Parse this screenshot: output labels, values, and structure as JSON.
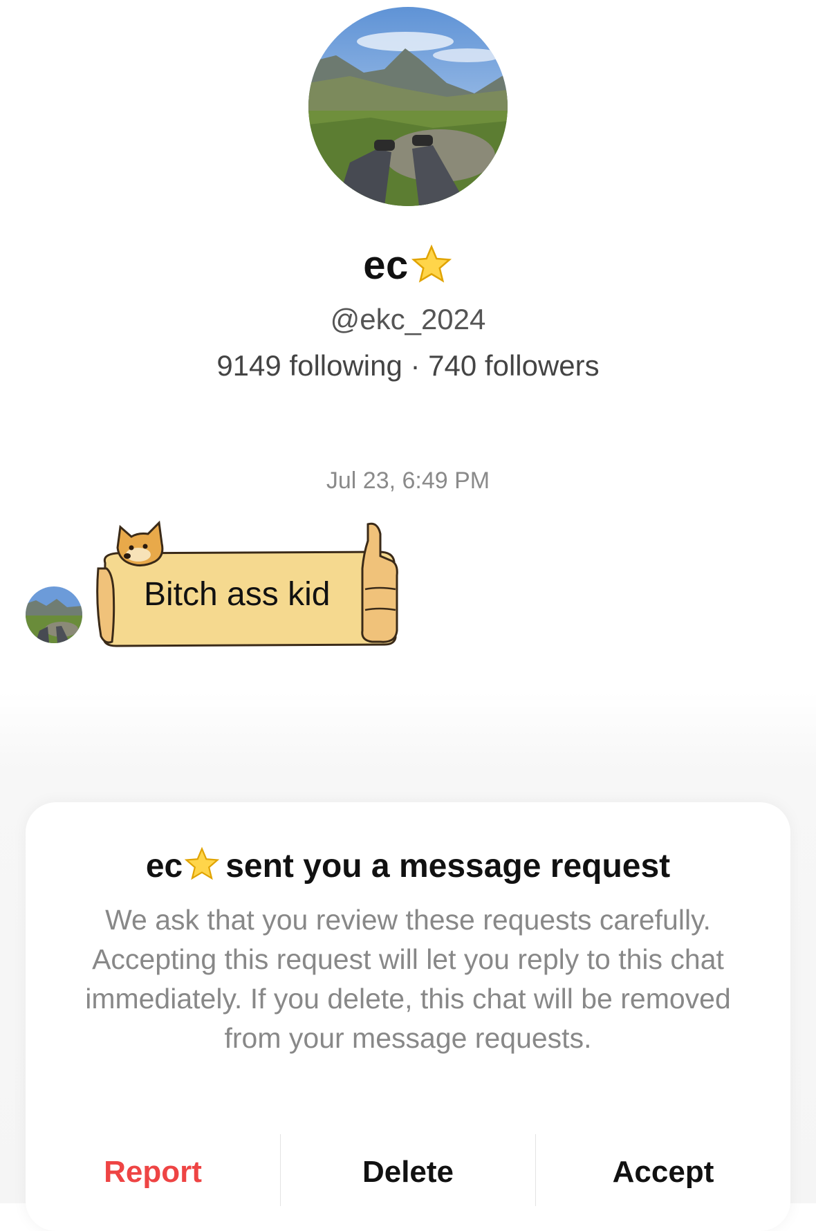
{
  "profile": {
    "name": "ec",
    "name_emoji": "star-emoji",
    "handle": "@ekc_2024",
    "stats": "9149 following · 740 followers",
    "avatar": "mountain-landscape-photo"
  },
  "conversation": {
    "timestamp": "Jul 23, 6:49 PM",
    "messages": [
      {
        "sender": "ec",
        "type": "sticker",
        "sticker": "doge-sign-sticker",
        "text": "Bitch ass kid"
      }
    ]
  },
  "request_card": {
    "title_name": "ec",
    "title_suffix": "sent you a message request",
    "body": "We ask that you review these requests carefully. Accepting this request will let you reply to this chat immediately. If you delete, this chat will be removed from your message requests.",
    "actions": {
      "report": "Report",
      "delete": "Delete",
      "accept": "Accept"
    }
  },
  "colors": {
    "report": "#ee4444",
    "sticker_fill": "#f5d98f",
    "secondary_text": "#888888"
  }
}
